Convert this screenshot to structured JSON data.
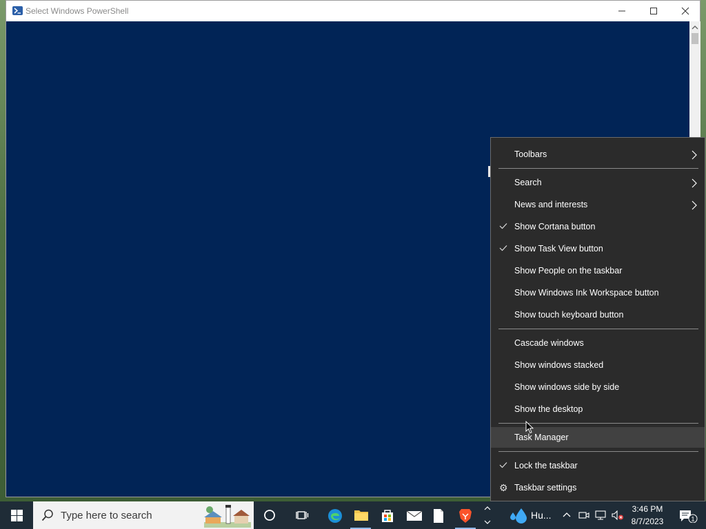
{
  "window": {
    "title": "Select Windows PowerShell"
  },
  "context_menu": {
    "items": [
      {
        "label": "Toolbars"
      },
      {
        "label": "Search"
      },
      {
        "label": "News and interests"
      },
      {
        "label": "Show Cortana button",
        "checked": true
      },
      {
        "label": "Show Task View button",
        "checked": true
      },
      {
        "label": "Show People on the taskbar"
      },
      {
        "label": "Show Windows Ink Workspace button"
      },
      {
        "label": "Show touch keyboard button"
      },
      {
        "label": "Cascade windows"
      },
      {
        "label": "Show windows stacked"
      },
      {
        "label": "Show windows side by side"
      },
      {
        "label": "Show the desktop"
      },
      {
        "label": "Task Manager"
      },
      {
        "label": "Lock the taskbar",
        "checked": true
      },
      {
        "label": "Taskbar settings"
      }
    ]
  },
  "taskbar": {
    "search_placeholder": "Type here to search",
    "weather_label": "Hu...",
    "time": "3:46 PM",
    "date": "8/7/2023",
    "notification_count": "1"
  },
  "colors": {
    "console_bg": "#012456",
    "menu_bg": "#2b2b2b",
    "taskbar_bg": "#1f2c37"
  }
}
